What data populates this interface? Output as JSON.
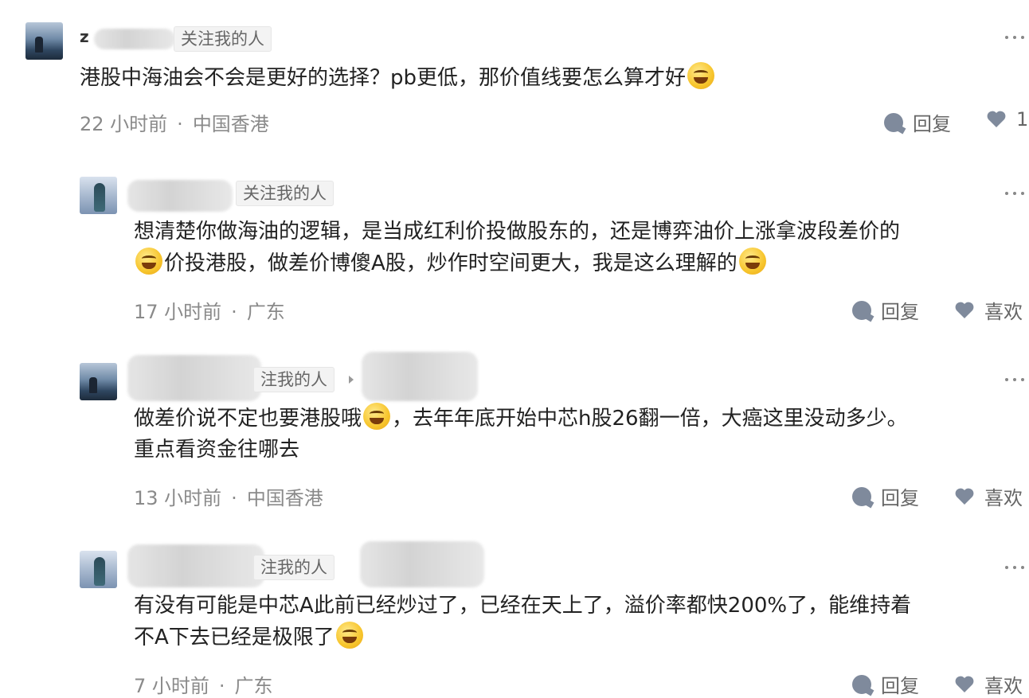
{
  "comments": [
    {
      "follow_tag": "关注我的人",
      "username_partial": "z",
      "text_lines": [
        "港股中海油会不会是更好的选择？pb更低，那价值线要怎么算才好"
      ],
      "time": "22 小时前",
      "location": "中国香港",
      "reply_label": "回复",
      "like_label": "1"
    },
    {
      "follow_tag": "关注我的人",
      "text_lines": [
        "想清楚你做海油的逻辑，是当成红利价投做股东的，还是博弈油价上涨拿波段差价的",
        "价投港股，做差价博傻A股，炒作时空间更大，我是这么理解的"
      ],
      "time": "17 小时前",
      "location": "广东",
      "reply_label": "回复",
      "like_label": "喜欢"
    },
    {
      "follow_tag": "注我的人",
      "text_lines": [
        "做差价说不定也要港股哦",
        "，去年年底开始中芯h股26翻一倍，大癌这里没动多少。",
        "重点看资金往哪去"
      ],
      "time": "13 小时前",
      "location": "中国香港",
      "reply_label": "回复",
      "like_label": "喜欢"
    },
    {
      "follow_tag": "注我的人",
      "text_lines": [
        "有没有可能是中芯A此前已经炒过了，已经在天上了，溢价率都快200%了，能维持着",
        "不A下去已经是极限了"
      ],
      "time": "7 小时前",
      "location": "广东",
      "reply_label": "回复",
      "like_label": "喜欢"
    }
  ],
  "separator": "·",
  "icons": {
    "reply": "comment-bubble-icon",
    "like": "heart-icon",
    "more": "more-dots-icon",
    "emoji_laugh": "rofl-emoji-icon",
    "emoji_smile": "grin-emoji-icon",
    "emoji_monocle": "monocle-emoji-icon"
  },
  "colors": {
    "icon_gray": "#7f8a9c",
    "meta_gray": "#8a8a8a",
    "text": "#222222"
  }
}
